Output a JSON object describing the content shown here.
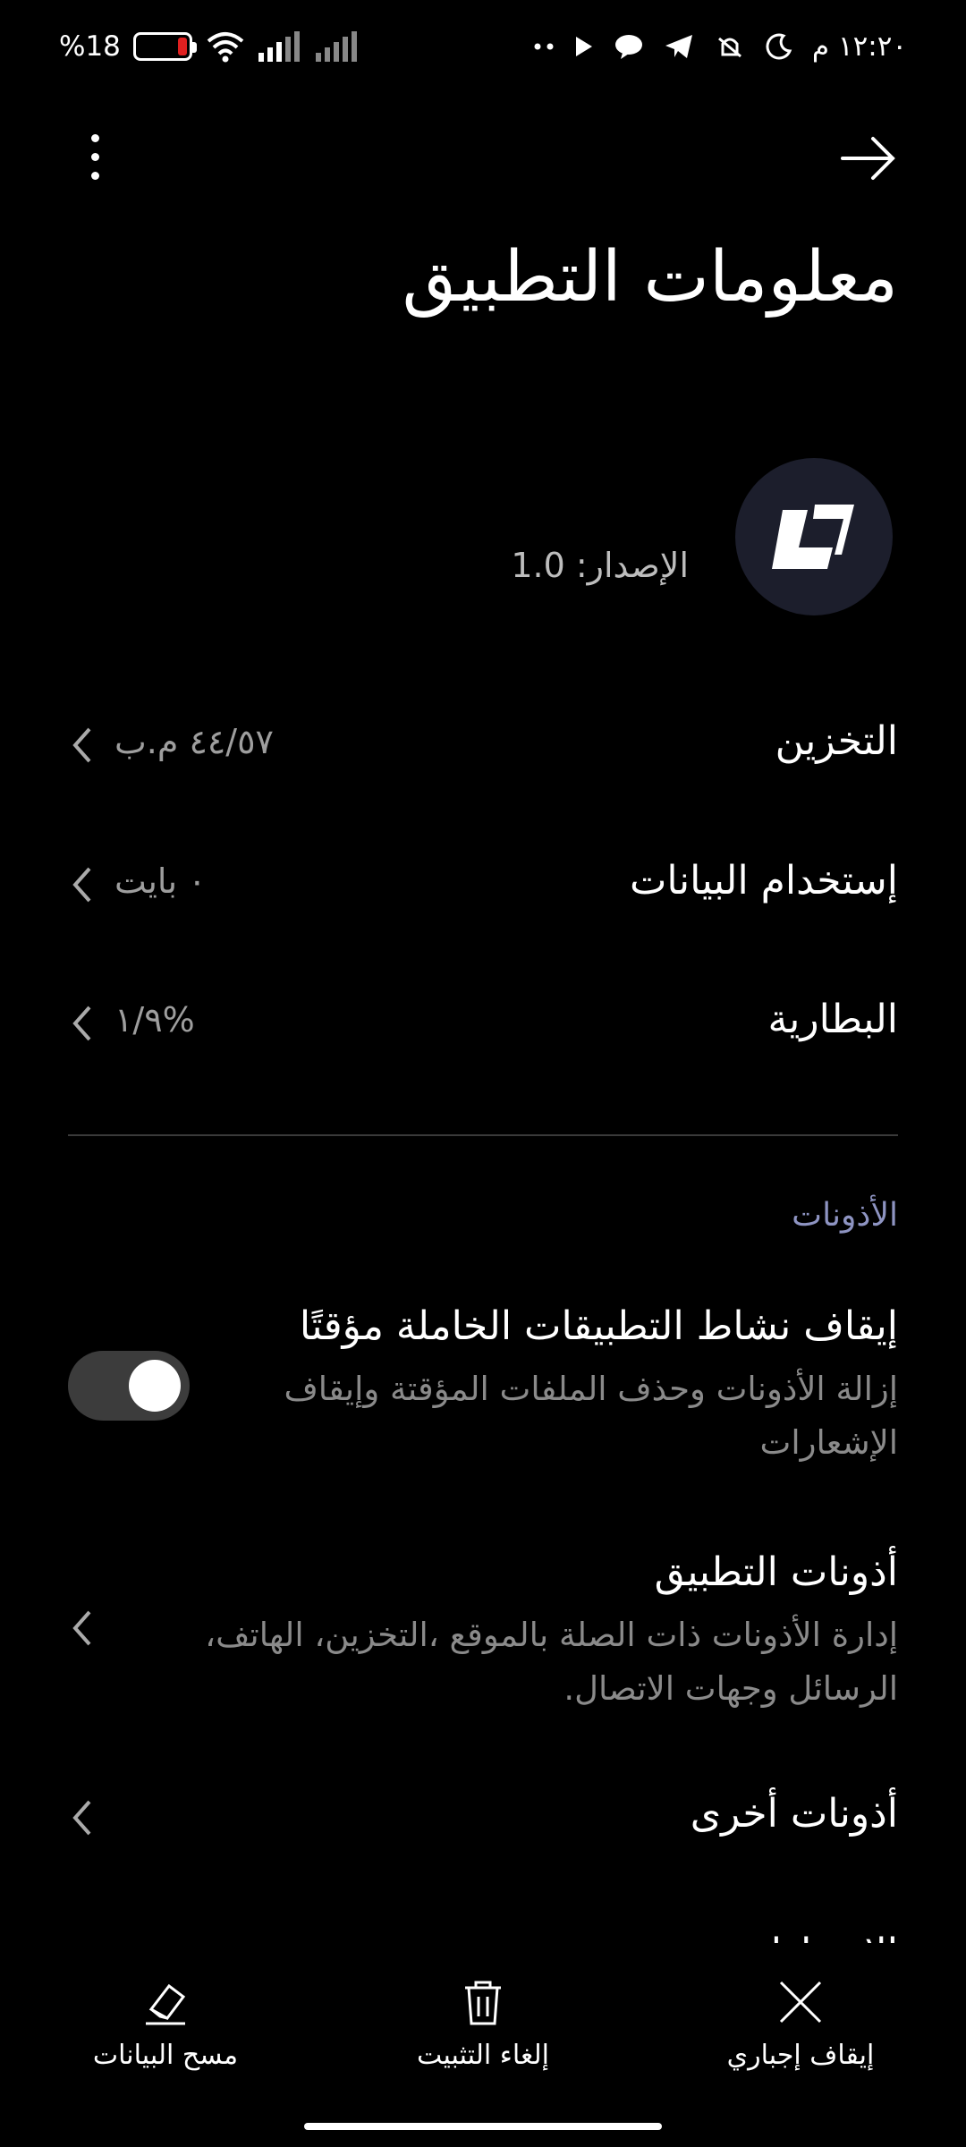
{
  "status_bar": {
    "battery_percent": "%18",
    "battery_level": 0.18,
    "time": "١٢:٢٠ م",
    "icons": [
      "wifi-icon",
      "signal-icon",
      "signal-icon",
      "dots-icon",
      "play-icon",
      "chat-icon",
      "telegram-icon",
      "mute-icon",
      "moon-icon"
    ],
    "colors": {
      "battery_low": "#e02020"
    }
  },
  "header": {
    "title": "معلومات التطبيق",
    "back_icon": "arrow-icon",
    "menu_icon": "more-vertical-icon"
  },
  "app": {
    "version": "الإصدار: 1.0",
    "icon": "app-logo-icon"
  },
  "rows": [
    {
      "title": "التخزين",
      "value": "٤٤/٥٧ م.ب"
    },
    {
      "title": "إستخدام البيانات",
      "value": "٠ بايت"
    },
    {
      "title": "البطارية",
      "value": "%١/٩"
    }
  ],
  "permissions": {
    "section_label": "الأذونات",
    "pause_inactive": {
      "title": "إيقاف نشاط التطبيقات الخاملة مؤقتًا",
      "desc": "إزالة الأذونات وحذف الملفات المؤقتة وإيقاف الإشعارات",
      "enabled": true
    },
    "app_permissions": {
      "title": "أذونات التطبيق",
      "desc": "إدارة الأذونات ذات الصلة بالموقع ،التخزين، الهاتف، الرسائل وجهات الاتصال."
    },
    "other_permissions": {
      "title": "أذونات أخرى"
    },
    "notifications_partial": {
      "title": "الإشعارات"
    }
  },
  "bottom_actions": {
    "force_stop": "إيقاف إجباري",
    "uninstall": "إلغاء التثبيت",
    "clear_data": "مسح البيانات"
  },
  "colors": {
    "background": "#000000",
    "section_label": "#8e94c2",
    "secondary_text": "#9e9e9e",
    "app_icon_bg": "#1c1e2c"
  }
}
